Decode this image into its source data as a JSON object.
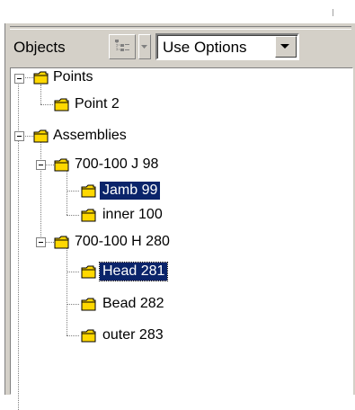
{
  "toolbar": {
    "objects_label": "Objects",
    "combo_value": "Use Options"
  },
  "tree": {
    "points": {
      "label": "Points",
      "children": [
        {
          "label": "Point 2"
        }
      ]
    },
    "assemblies": {
      "label": "Assemblies",
      "groups": [
        {
          "label": "700-100 J 98",
          "children": [
            {
              "label": "Jamb 99",
              "selected": true
            },
            {
              "label": "inner 100"
            }
          ]
        },
        {
          "label": "700-100 H 280",
          "children": [
            {
              "label": "Head 281",
              "selected": true,
              "focused": true
            },
            {
              "label": "Bead 282"
            },
            {
              "label": "outer 283"
            }
          ]
        }
      ]
    }
  },
  "colors": {
    "selection": "#0a246a",
    "panel": "#d4d0c8",
    "folder": "#ffd800"
  },
  "icons": [
    "tree-view-icon",
    "chevron-down-icon",
    "folder-icon",
    "collapse-minus-icon"
  ]
}
